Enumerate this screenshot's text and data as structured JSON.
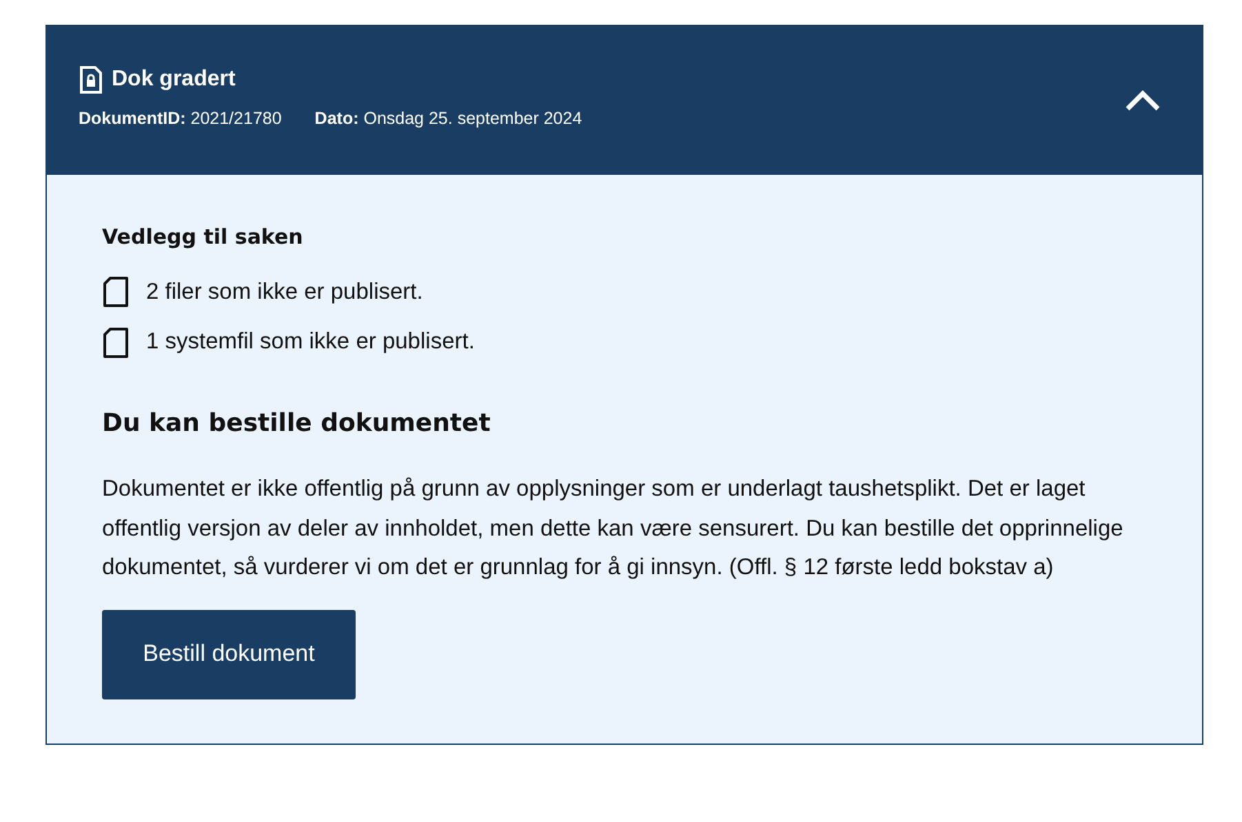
{
  "header": {
    "title": "Dok gradert",
    "expanded": true,
    "meta": [
      "**DokumentID:** 2021/21780",
      "**Dato:** Onsdag 25. september 2024"
    ]
  },
  "attachments": {
    "heading": "Vedlegg til saken",
    "items": [
      "2 filer som ikke er publisert.",
      "1 systemfil som ikke er publisert."
    ]
  },
  "order": {
    "heading": "Du kan bestille dokumentet",
    "text": "Dokumentet er ikke offentlig på grunn av opplysninger som er underlagt taushetsplikt. Det er laget offentlig versjon av deler av innholdet, men dette kan være sensurert. Du kan bestille det opprinnelige dokumentet, så vurderer vi om det er grunnlag for å gi innsyn. (Offl. § 12 første ledd bokstav a)",
    "button": "Bestill dokument"
  }
}
